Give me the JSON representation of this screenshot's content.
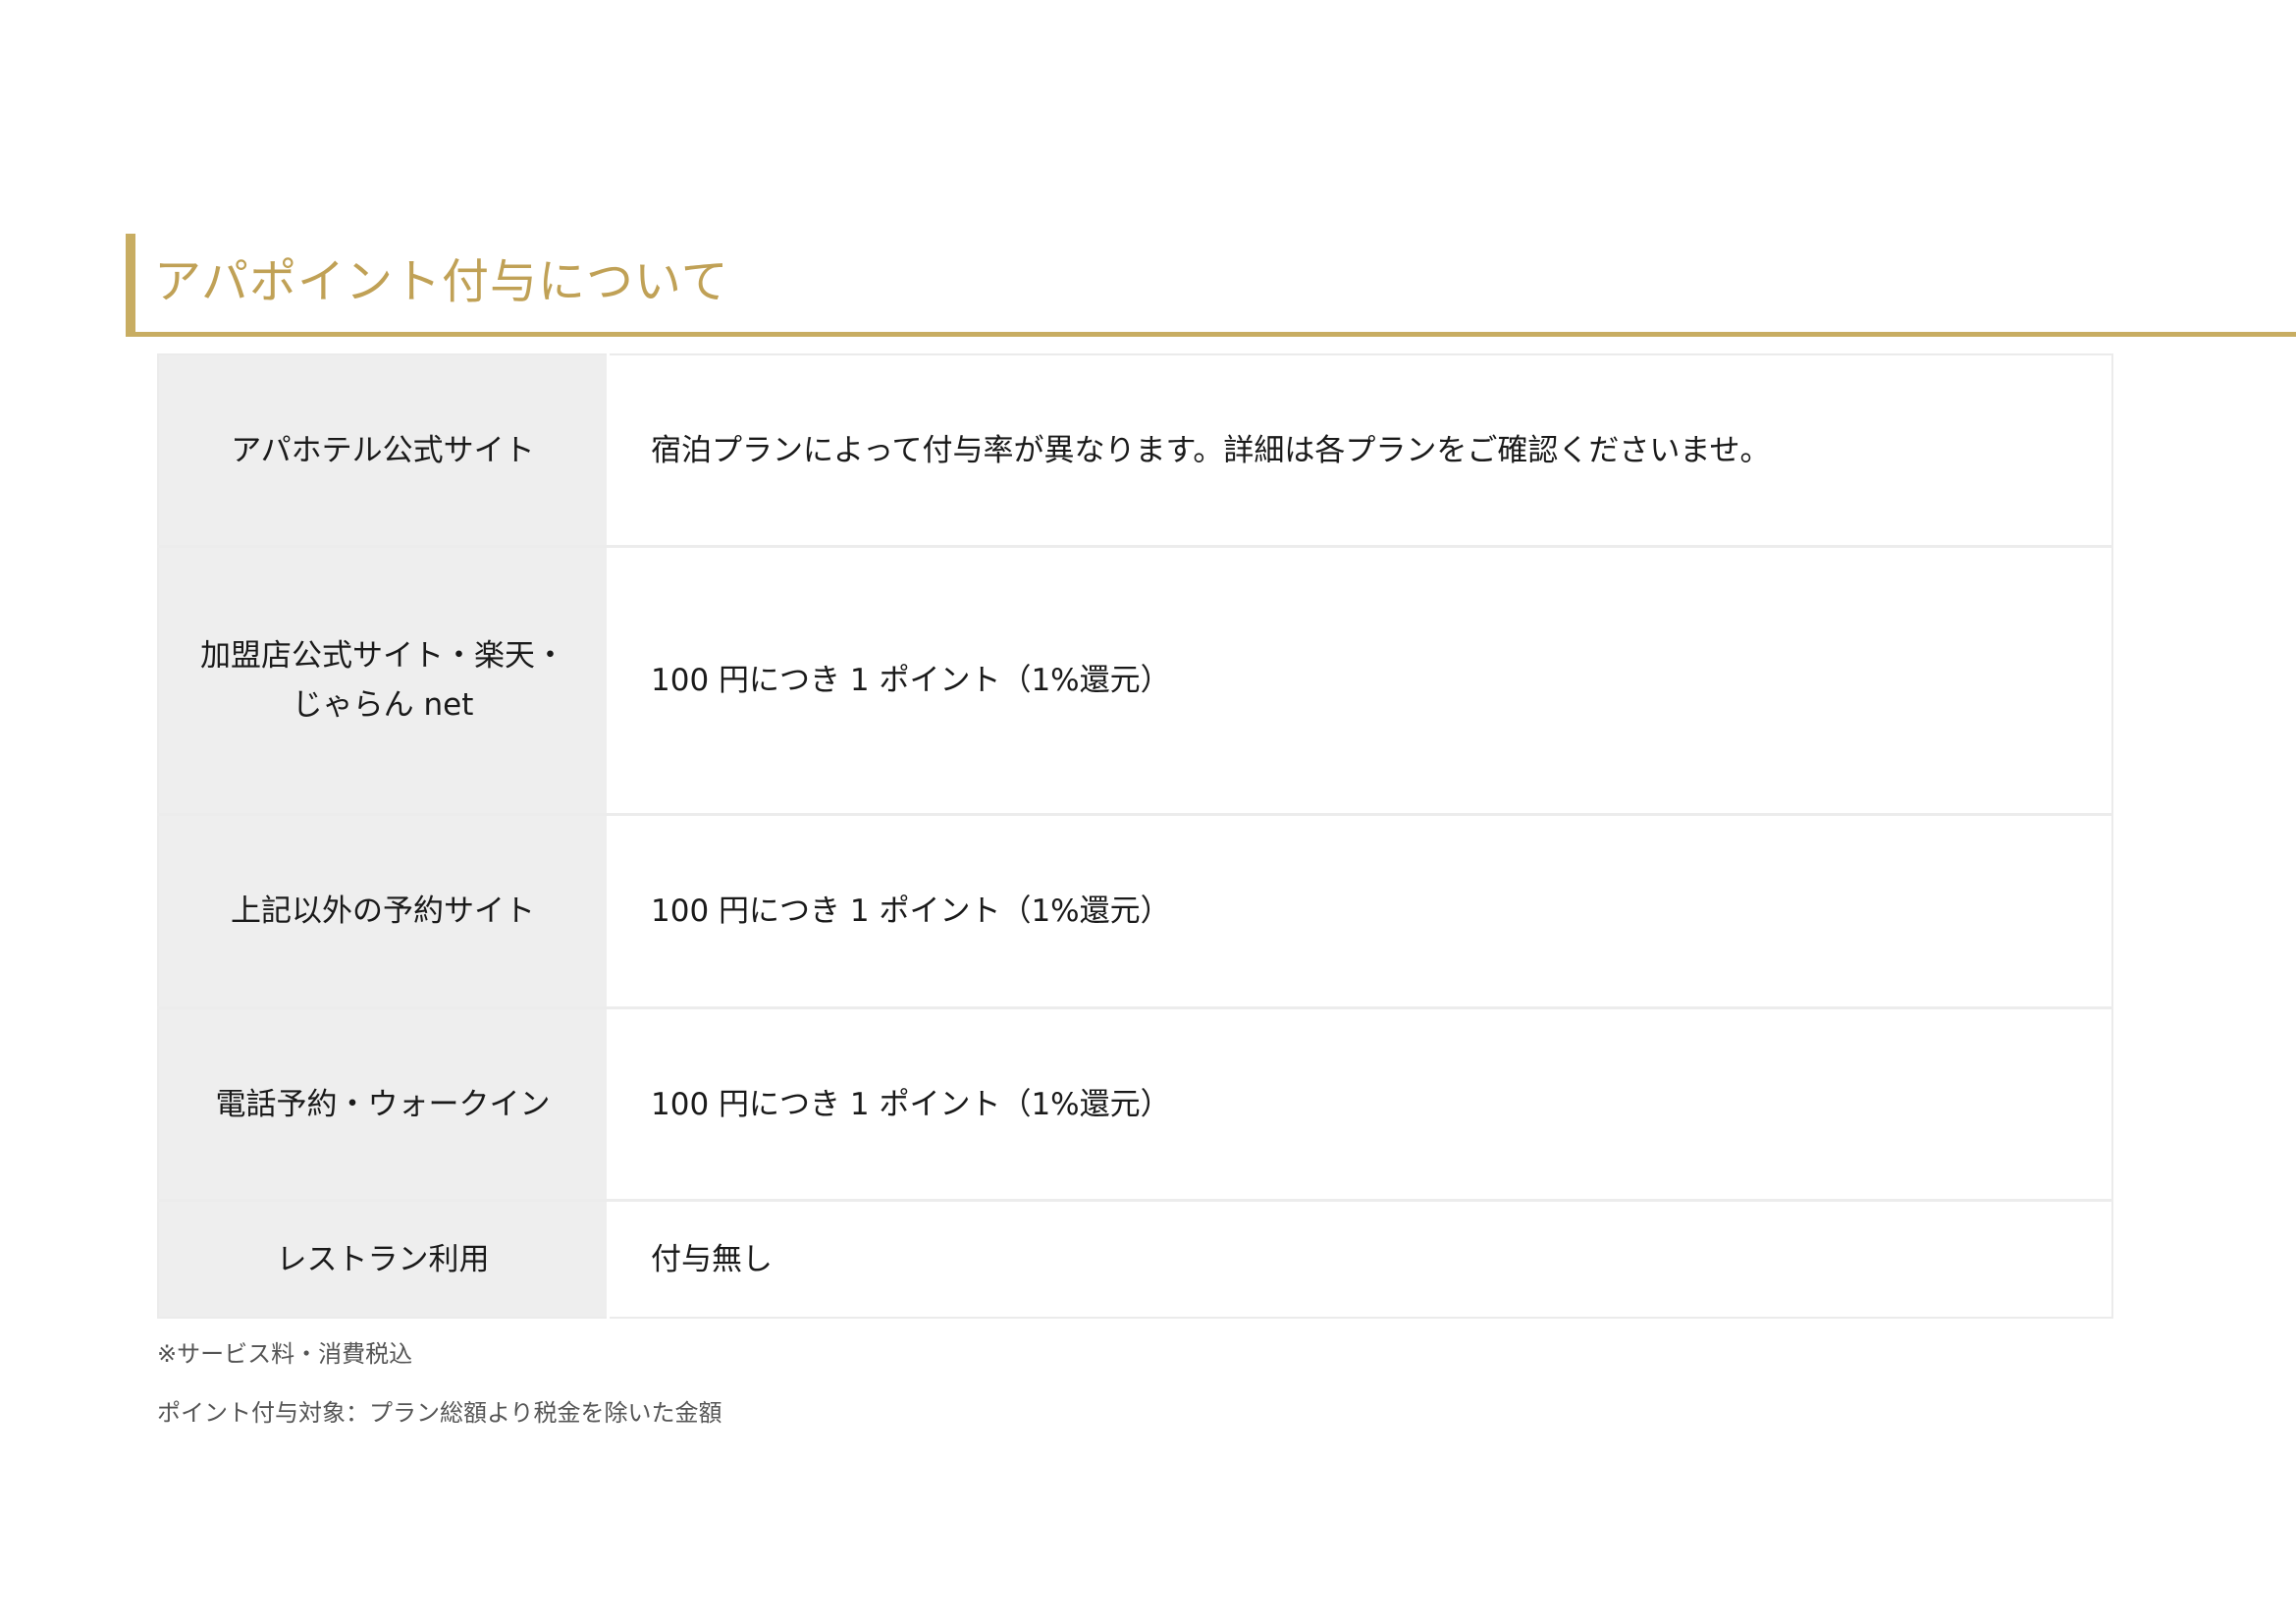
{
  "section": {
    "title": "アパポイント付与について",
    "accent_color": "#c8ad62"
  },
  "table": {
    "rows": [
      {
        "label_lines": [
          "アパホテル公式サイト"
        ],
        "value": "宿泊プランによって付与率が異なります。詳細は各プランをご確認くださいませ。"
      },
      {
        "label_lines": [
          "加盟店公式サイト・楽天・",
          "じゃらん net"
        ],
        "value": "100 円につき 1 ポイント（1%還元）"
      },
      {
        "label_lines": [
          "上記以外の予約サイト"
        ],
        "value": "100 円につき 1 ポイント（1%還元）"
      },
      {
        "label_lines": [
          "電話予約・ウォークイン"
        ],
        "value": "100 円につき 1 ポイント（1%還元）"
      },
      {
        "label_lines": [
          "レストラン利用"
        ],
        "value": "付与無し"
      }
    ]
  },
  "notes": [
    "※サービス料・消費税込",
    "ポイント付与対象：プラン総額より税金を除いた金額"
  ]
}
